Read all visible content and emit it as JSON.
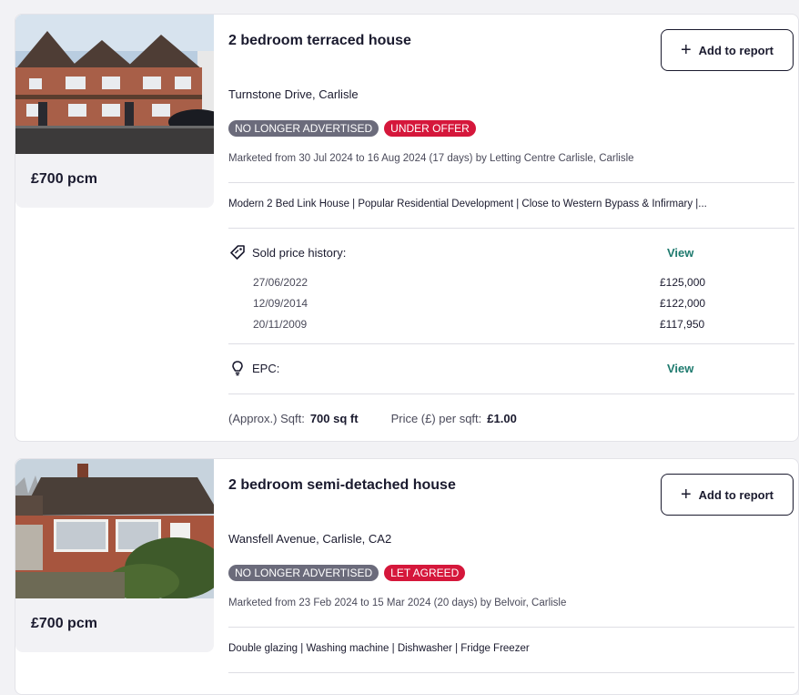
{
  "listings": [
    {
      "price": "£700 pcm",
      "title": "2 bedroom terraced house",
      "add_button": "Add to report",
      "address": "Turnstone Drive, Carlisle",
      "status_badge": "NO LONGER ADVERTISED",
      "offer_badge": "UNDER OFFER",
      "marketed": "Marketed from 30 Jul 2024 to 16 Aug 2024 (17 days) by Letting Centre Carlisle, Carlisle",
      "description": "Modern 2 Bed Link House | Popular Residential Development | Close to Western Bypass & Infirmary |...",
      "sold_history_label": "Sold price history:",
      "sold_history_view": "View",
      "sold_history": [
        {
          "date": "27/06/2022",
          "price": "£125,000"
        },
        {
          "date": "12/09/2014",
          "price": "£122,000"
        },
        {
          "date": "20/11/2009",
          "price": "£117,950"
        }
      ],
      "epc_label": "EPC:",
      "epc_view": "View",
      "sqft_label": "(Approx.) Sqft:",
      "sqft_value": "700 sq ft",
      "ppsf_label": "Price (£) per sqft:",
      "ppsf_value": "£1.00"
    },
    {
      "price": "£700 pcm",
      "title": "2 bedroom semi-detached house",
      "add_button": "Add to report",
      "address": "Wansfell Avenue, Carlisle, CA2",
      "status_badge": "NO LONGER ADVERTISED",
      "offer_badge": "LET AGREED",
      "marketed": "Marketed from 23 Feb 2024 to 15 Mar 2024 (20 days) by Belvoir, Carlisle",
      "description": "Double glazing | Washing machine | Dishwasher | Fridge Freezer"
    }
  ],
  "colors": {
    "badge_grey": "#6b6b7b",
    "badge_red": "#d5173b",
    "link_teal": "#1e7a6e"
  }
}
